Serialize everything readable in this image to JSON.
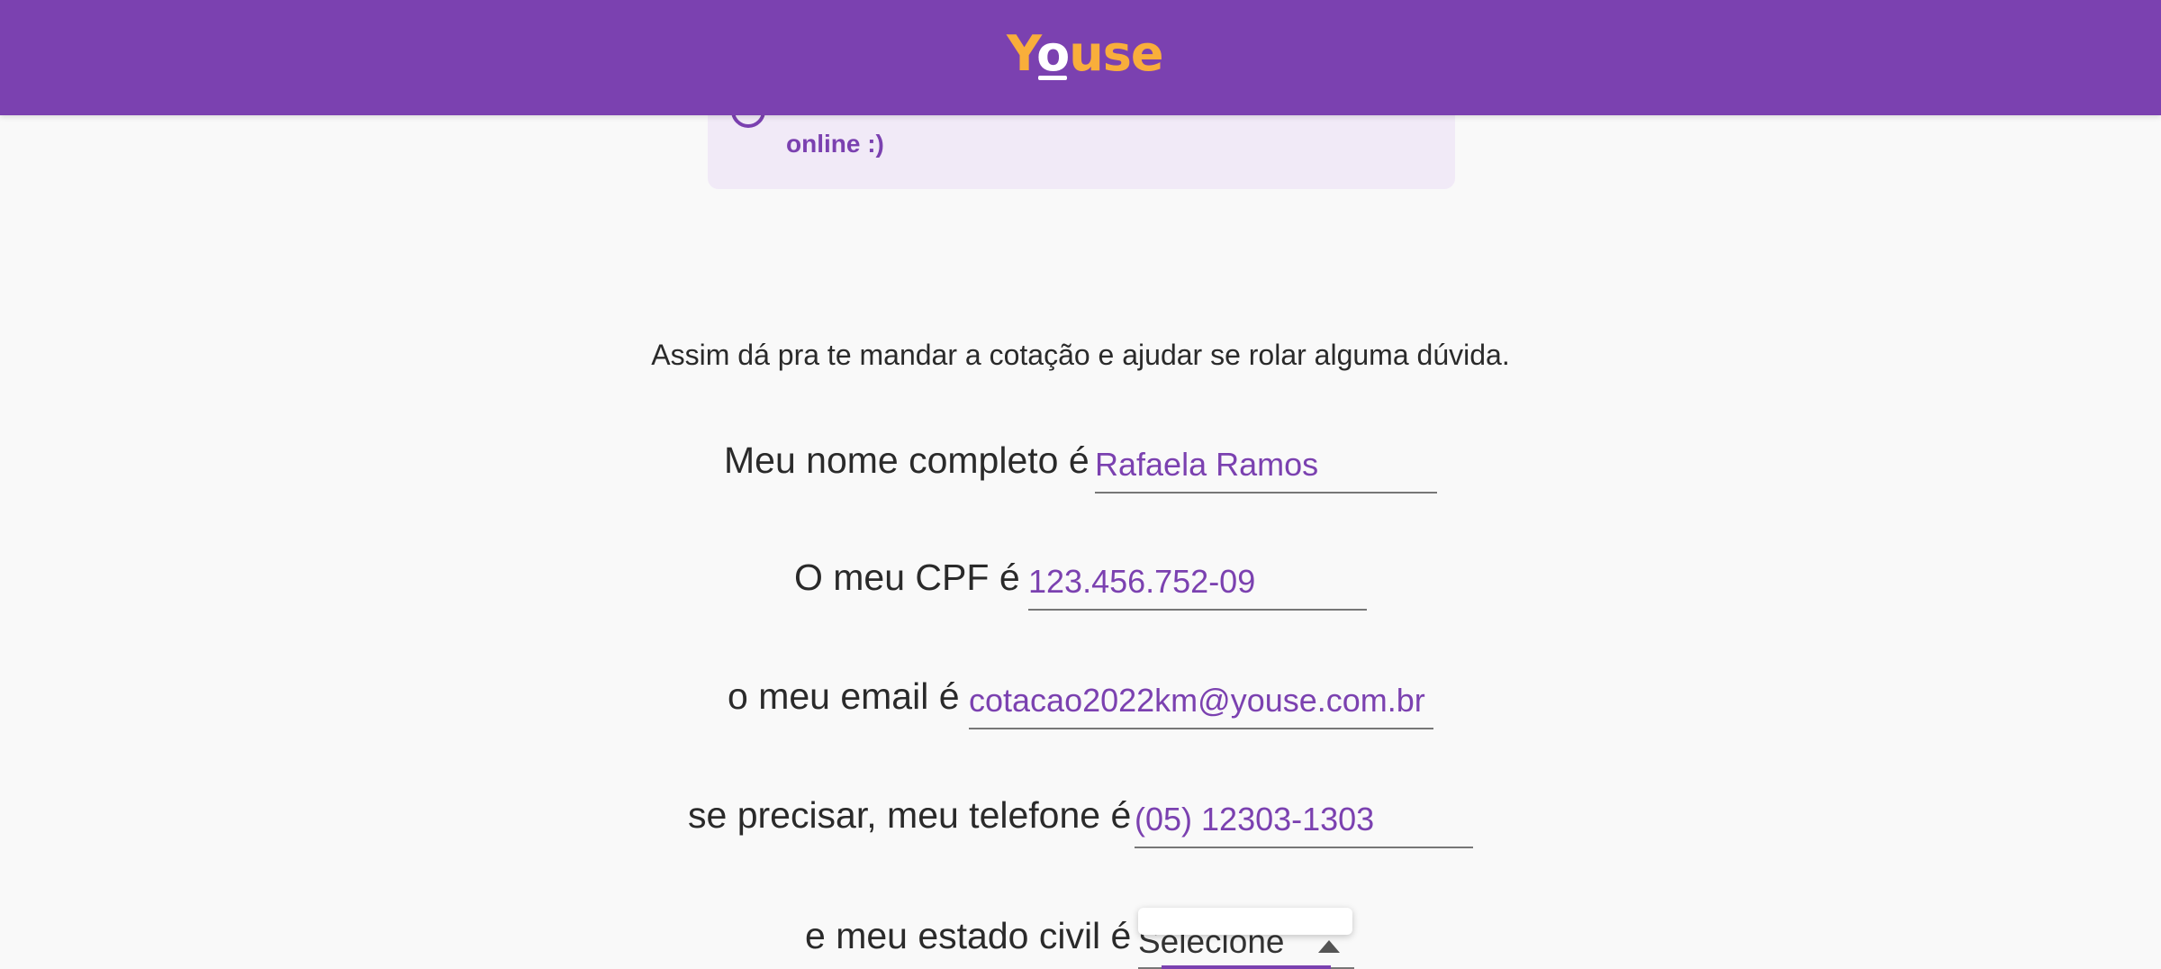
{
  "header": {
    "logo_prefix": "Y",
    "logo_o": "o",
    "logo_suffix": "use"
  },
  "notice": {
    "text": "online :)"
  },
  "form": {
    "subtitle": "Assim dá pra te mandar a cotação e ajudar se rolar alguma dúvida.",
    "name": {
      "label": "Meu nome completo é",
      "value": "Rafaela Ramos"
    },
    "cpf": {
      "label": "O meu CPF é",
      "value": "123.456.752-09"
    },
    "email": {
      "label": "o meu email é",
      "value": "cotacao2022km@youse.com.br"
    },
    "phone": {
      "label": "se precisar, meu telefone é",
      "value": "(05) 12303-1303"
    },
    "marital": {
      "label": "e meu estado civil é",
      "value": "Selecione"
    }
  },
  "colors": {
    "brand": "#7b41b0",
    "logo": "#f9ae3b",
    "background": "#f9f9f9"
  },
  "icons": {
    "notice": "info-circle-icon",
    "select": "caret-up-icon"
  }
}
